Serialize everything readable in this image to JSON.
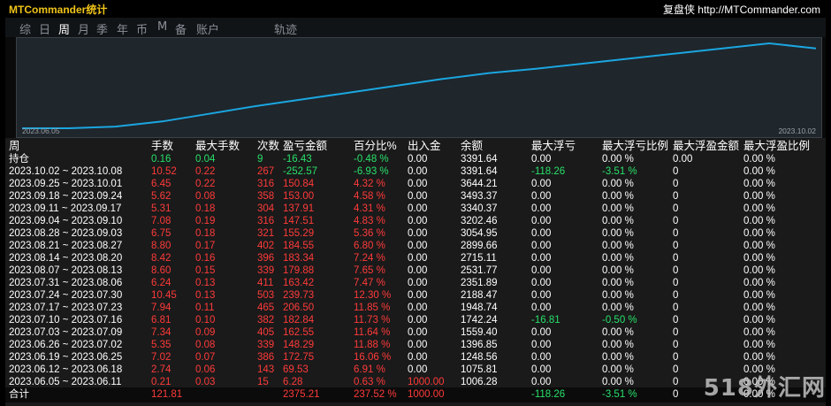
{
  "window": {
    "title": "MTCommander统计",
    "brand": "复盘侠 http://MTCommander.com"
  },
  "tabs": [
    "综",
    "日",
    "周",
    "月",
    "季",
    "年",
    "币",
    "M",
    "备",
    "账户",
    "轨迹"
  ],
  "active_tab": "周",
  "chart": {
    "start_label": "2023.06.05",
    "end_label": "2023.10.02",
    "line_color": "#1ba6e0",
    "points": [
      0.0,
      0.0,
      0.02,
      0.08,
      0.17,
      0.26,
      0.34,
      0.42,
      0.5,
      0.58,
      0.65,
      0.7,
      0.76,
      0.82,
      0.88,
      0.94,
      1.0,
      0.94
    ]
  },
  "headers": [
    "周",
    "手数",
    "最大手数",
    "次数",
    "盈亏金额",
    "百分比%",
    "出入金",
    "余额",
    "最大浮亏",
    "最大浮亏比例",
    "最大浮盈金额",
    "最大浮盈比例"
  ],
  "holding_row": [
    "持仓",
    "0.16",
    "0.04",
    "9",
    "-16.43",
    "-0.48 %",
    "0.00",
    "3391.64",
    "0.00",
    "0.00 %",
    "0.00",
    "0.00 %"
  ],
  "rows": [
    [
      "2023.10.02 ~ 2023.10.08",
      "10.52",
      "0.22",
      "267",
      "-252.57",
      "-6.93 %",
      "0.00",
      "3391.64",
      "-118.26",
      "-3.51 %",
      "0",
      "0.00 %"
    ],
    [
      "2023.09.25 ~ 2023.10.01",
      "6.45",
      "0.22",
      "316",
      "150.84",
      "4.32 %",
      "0.00",
      "3644.21",
      "0.00",
      "0.00 %",
      "0",
      "0.00 %"
    ],
    [
      "2023.09.18 ~ 2023.09.24",
      "5.62",
      "0.08",
      "358",
      "153.00",
      "4.58 %",
      "0.00",
      "3493.37",
      "0.00",
      "0.00 %",
      "0",
      "0.00 %"
    ],
    [
      "2023.09.11 ~ 2023.09.17",
      "5.31",
      "0.18",
      "304",
      "137.91",
      "4.31 %",
      "0.00",
      "3340.37",
      "0.00",
      "0.00 %",
      "0",
      "0.00 %"
    ],
    [
      "2023.09.04 ~ 2023.09.10",
      "7.08",
      "0.19",
      "316",
      "147.51",
      "4.83 %",
      "0.00",
      "3202.46",
      "0.00",
      "0.00 %",
      "0",
      "0.00 %"
    ],
    [
      "2023.08.28 ~ 2023.09.03",
      "6.75",
      "0.18",
      "321",
      "155.29",
      "5.36 %",
      "0.00",
      "3054.95",
      "0.00",
      "0.00 %",
      "0",
      "0.00 %"
    ],
    [
      "2023.08.21 ~ 2023.08.27",
      "8.80",
      "0.17",
      "402",
      "184.55",
      "6.80 %",
      "0.00",
      "2899.66",
      "0.00",
      "0.00 %",
      "0",
      "0.00 %"
    ],
    [
      "2023.08.14 ~ 2023.08.20",
      "8.42",
      "0.16",
      "396",
      "183.34",
      "7.24 %",
      "0.00",
      "2715.11",
      "0.00",
      "0.00 %",
      "0",
      "0.00 %"
    ],
    [
      "2023.08.07 ~ 2023.08.13",
      "8.60",
      "0.15",
      "339",
      "179.88",
      "7.65 %",
      "0.00",
      "2531.77",
      "0.00",
      "0.00 %",
      "0",
      "0.00 %"
    ],
    [
      "2023.07.31 ~ 2023.08.06",
      "6.24",
      "0.13",
      "411",
      "163.42",
      "7.47 %",
      "0.00",
      "2351.89",
      "0.00",
      "0.00 %",
      "0",
      "0.00 %"
    ],
    [
      "2023.07.24 ~ 2023.07.30",
      "10.45",
      "0.13",
      "503",
      "239.73",
      "12.30 %",
      "0.00",
      "2188.47",
      "0.00",
      "0.00 %",
      "0",
      "0.00 %"
    ],
    [
      "2023.07.17 ~ 2023.07.23",
      "7.94",
      "0.11",
      "465",
      "206.50",
      "11.85 %",
      "0.00",
      "1948.74",
      "0.00",
      "0.00 %",
      "0",
      "0.00 %"
    ],
    [
      "2023.07.10 ~ 2023.07.16",
      "6.81",
      "0.10",
      "382",
      "182.84",
      "11.73 %",
      "0.00",
      "1742.24",
      "-16.81",
      "-0.50 %",
      "0",
      "0.00 %"
    ],
    [
      "2023.07.03 ~ 2023.07.09",
      "7.34",
      "0.09",
      "405",
      "162.55",
      "11.64 %",
      "0.00",
      "1559.40",
      "0.00",
      "0.00 %",
      "0",
      "0.00 %"
    ],
    [
      "2023.06.26 ~ 2023.07.02",
      "5.35",
      "0.08",
      "339",
      "148.29",
      "11.88 %",
      "0.00",
      "1396.85",
      "0.00",
      "0.00 %",
      "0",
      "0.00 %"
    ],
    [
      "2023.06.19 ~ 2023.06.25",
      "7.02",
      "0.07",
      "386",
      "172.75",
      "16.06 %",
      "0.00",
      "1248.56",
      "0.00",
      "0.00 %",
      "0",
      "0.00 %"
    ],
    [
      "2023.06.12 ~ 2023.06.18",
      "2.74",
      "0.06",
      "143",
      "69.53",
      "6.91 %",
      "0.00",
      "1075.81",
      "0.00",
      "0.00 %",
      "0",
      "0.00 %"
    ],
    [
      "2023.06.05 ~ 2023.06.11",
      "0.21",
      "0.03",
      "15",
      "6.28",
      "0.63 %",
      "1000.00",
      "1006.28",
      "0.00",
      "0.00 %",
      "0",
      "0.00 %"
    ]
  ],
  "total_row": [
    "合计",
    "121.81",
    "",
    "",
    "2375.21",
    "237.52 %",
    "1000.00",
    "",
    "-118.26",
    "-3.51 %",
    "0",
    "0.00 %"
  ],
  "colors": {
    "profit": "#ff3a3a",
    "loss": "#28e06a",
    "header": "#ffffff"
  },
  "watermark": "518外汇网"
}
